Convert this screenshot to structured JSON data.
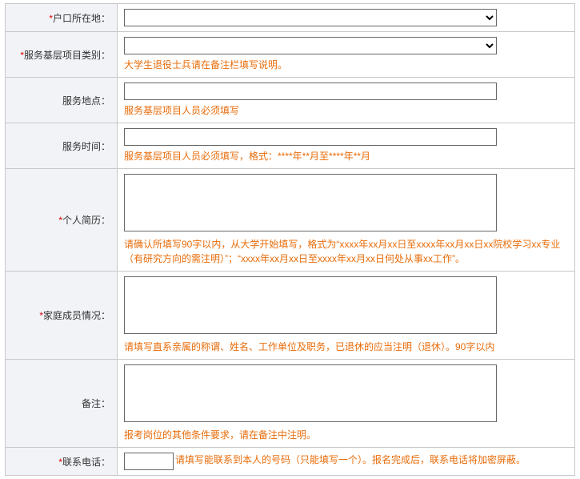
{
  "fields": {
    "hukou": {
      "label": "户口所在地：",
      "required": true
    },
    "project": {
      "label": "服务基层项目类别：",
      "required": true,
      "hint": "大学生退役士兵请在备注栏填写说明。"
    },
    "place": {
      "label": "服务地点：",
      "required": false,
      "hint": "服务基层项目人员必须填写"
    },
    "time": {
      "label": "服务时间：",
      "required": false,
      "hint": "服务基层项目人员必须填写，格式：****年**月至****年**月"
    },
    "resume": {
      "label": "个人简历：",
      "required": true,
      "hint": "请确认所填写90字以内，从大学开始填写，格式为“xxxx年xx月xx日至xxxx年xx月xx日xx院校学习xx专业（有研究方向的需注明）”；“xxxx年xx月xx日至xxxx年xx月xx日何处从事xx工作”。"
    },
    "family": {
      "label": "家庭成员情况：",
      "required": true,
      "hint": "请填写直系亲属的称谓、姓名、工作单位及职务，已退休的应当注明（退休）。90字以内"
    },
    "remark": {
      "label": "备注：",
      "required": false,
      "hint": "报考岗位的其他条件要求，请在备注中注明。"
    },
    "phone": {
      "label": "联系电话：",
      "required": true,
      "hint": "请填写能联系到本人的号码（只能填写一个）。报名完成后，联系电话将加密屏蔽。"
    }
  }
}
